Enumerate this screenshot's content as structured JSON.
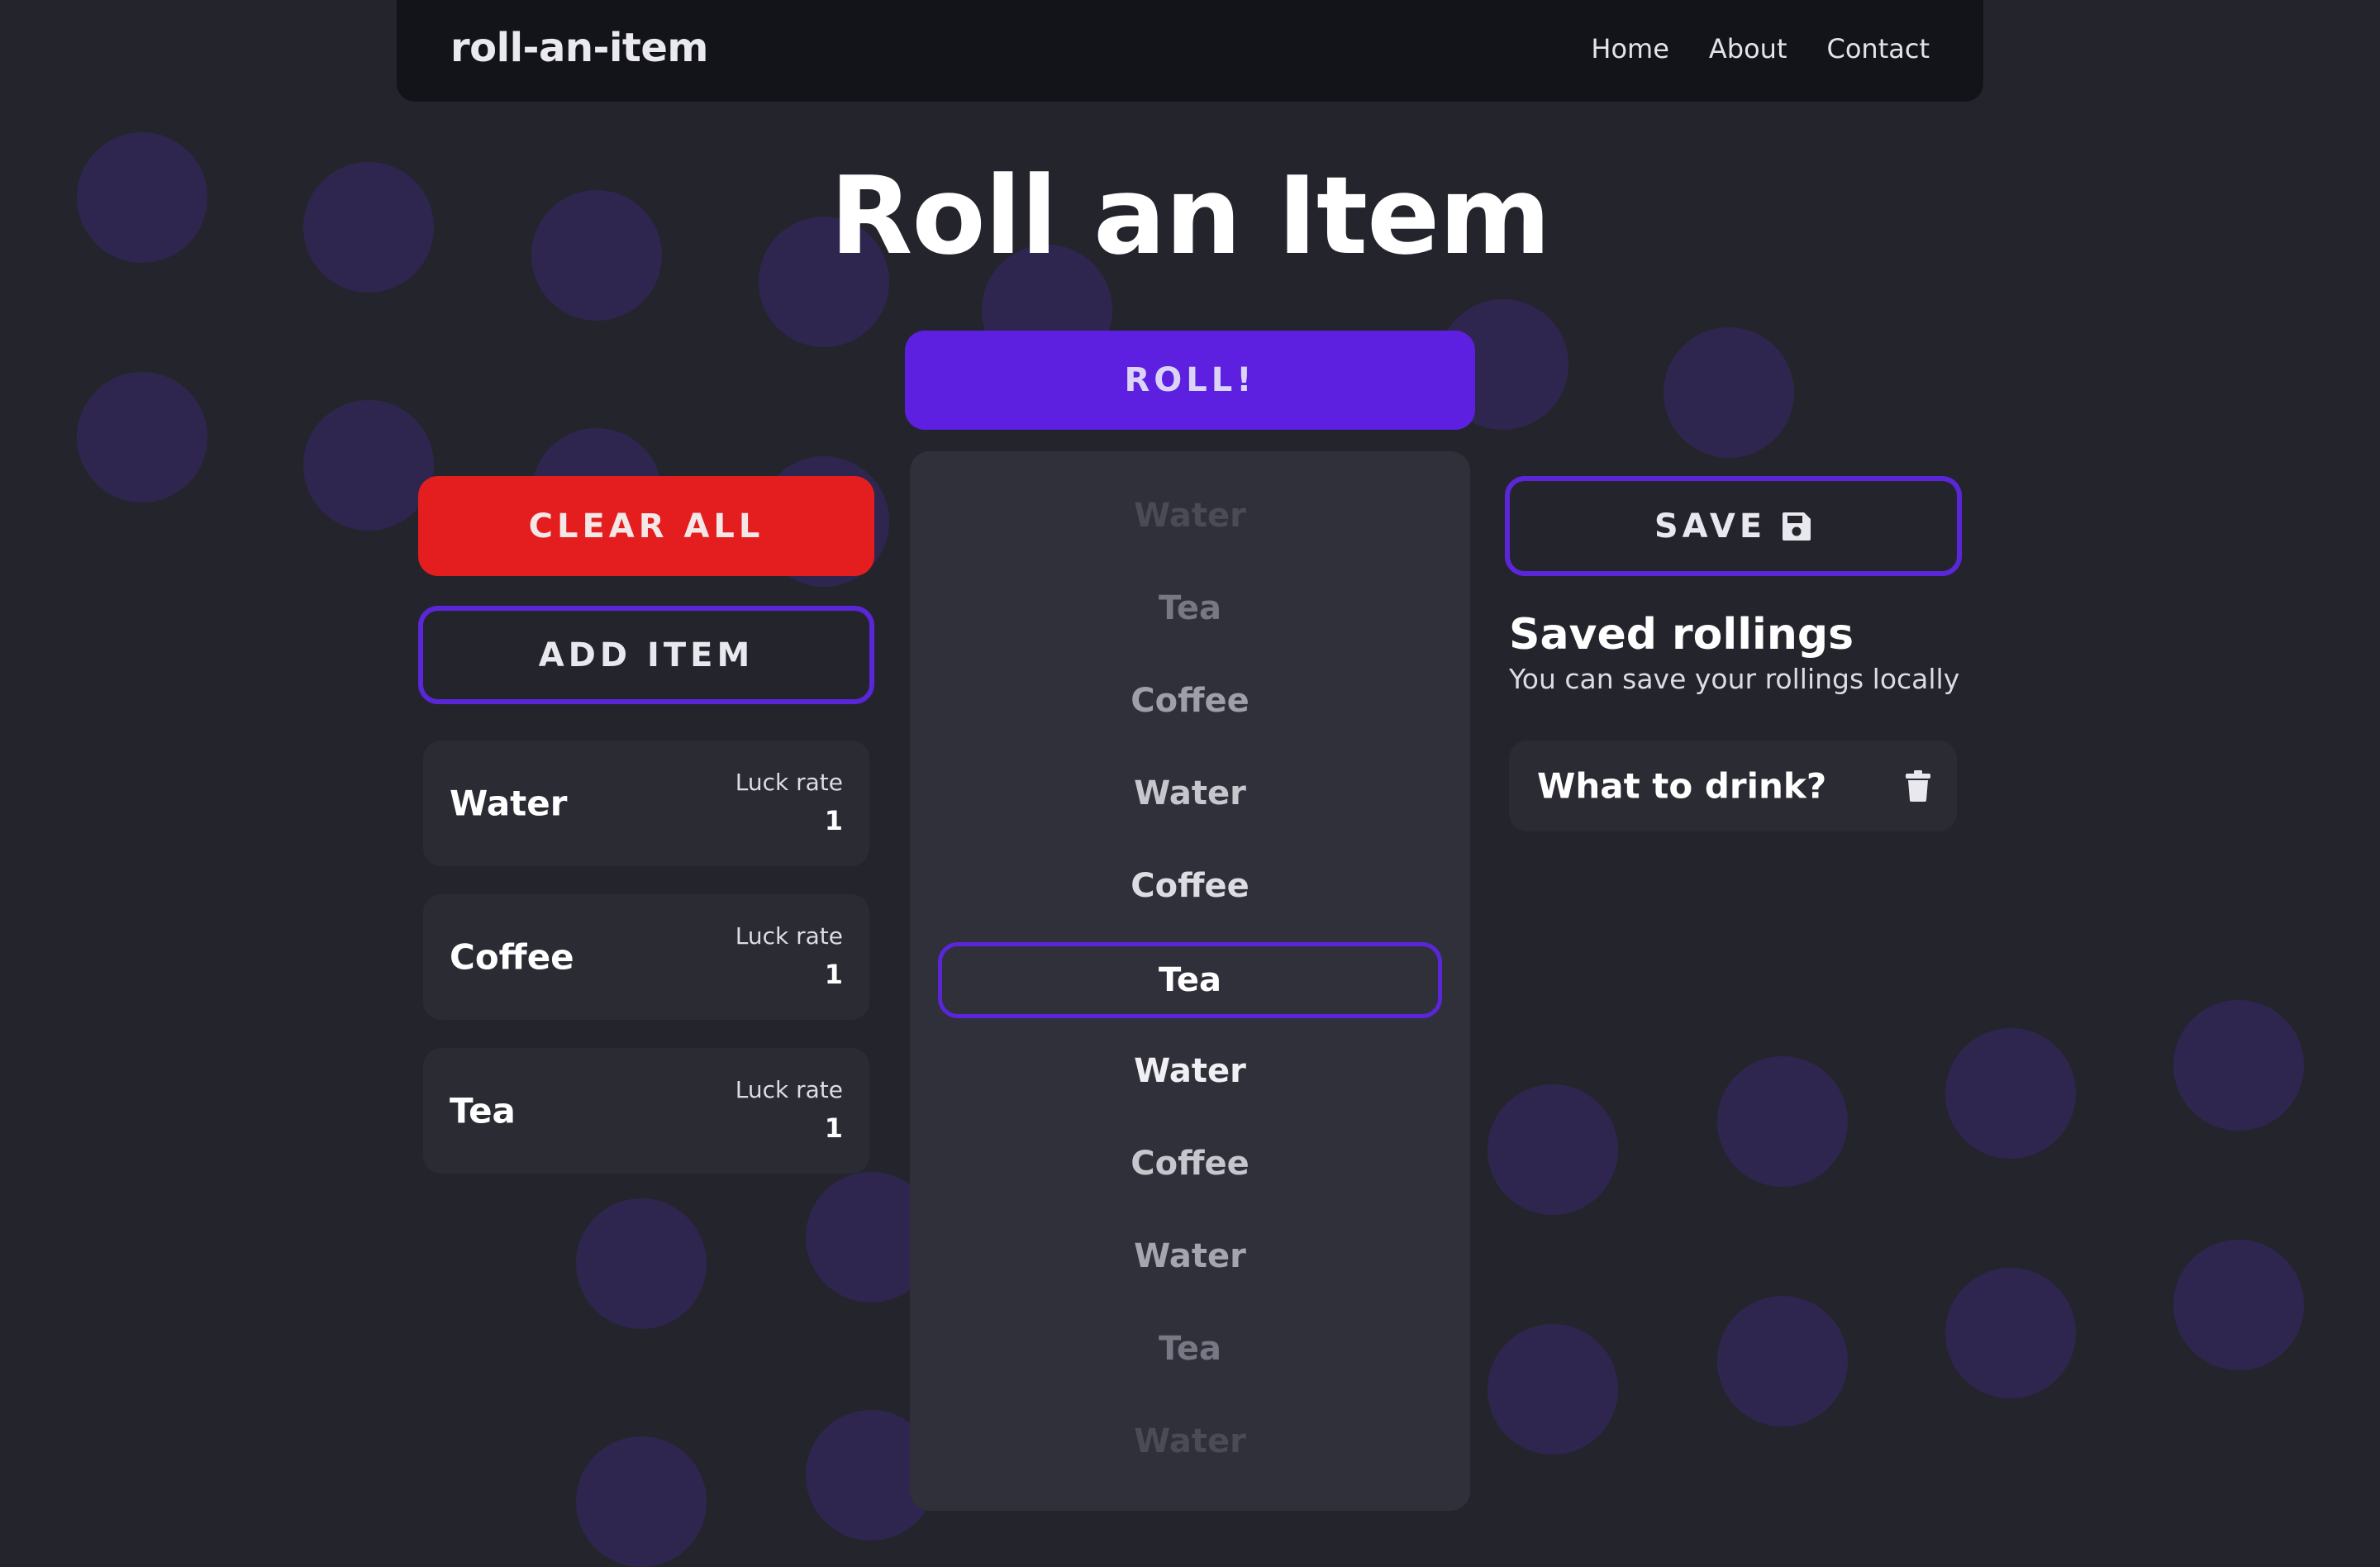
{
  "navbar": {
    "brand": "roll-an-item",
    "links": [
      "Home",
      "About",
      "Contact"
    ]
  },
  "page_title": "Roll an Item",
  "buttons": {
    "roll": "ROLL!",
    "clear_all": "CLEAR ALL",
    "add_item": "ADD ITEM",
    "save": "SAVE"
  },
  "items": [
    {
      "name": "Water",
      "luck_label": "Luck rate",
      "luck_rate": "1"
    },
    {
      "name": "Coffee",
      "luck_label": "Luck rate",
      "luck_rate": "1"
    },
    {
      "name": "Tea",
      "luck_label": "Luck rate",
      "luck_rate": "1"
    }
  ],
  "roller": {
    "entries": [
      "Water",
      "Tea",
      "Coffee",
      "Water",
      "Coffee",
      "Tea",
      "Water",
      "Coffee",
      "Water",
      "Tea",
      "Water"
    ],
    "selected_index": 5
  },
  "saved": {
    "title": "Saved rollings",
    "subtitle": "You can save your rollings locally",
    "entries": [
      {
        "name": "What to drink?"
      }
    ]
  },
  "colors": {
    "background": "#24242d",
    "accent": "#5d20e0",
    "danger": "#e41e1e",
    "card": "#2a2b33"
  },
  "icons": {
    "save": "floppy-disk-icon",
    "delete": "trash-icon"
  }
}
